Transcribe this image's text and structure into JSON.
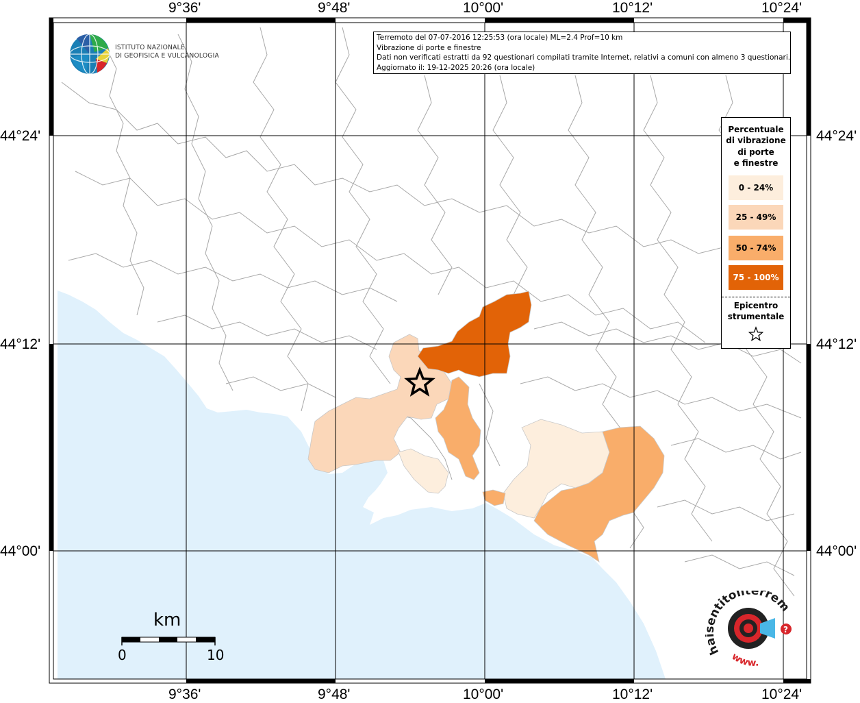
{
  "axes": {
    "top_ticks": [
      "9°36'",
      "9°48'",
      "10°00'",
      "10°12'",
      "10°24'"
    ],
    "bottom_ticks": [
      "9°36'",
      "9°48'",
      "10°00'",
      "10°12'",
      "10°24'"
    ],
    "left_ticks": [
      "44°24'",
      "44°12'",
      "44°00'"
    ],
    "right_ticks": [
      "44°24'",
      "44°12'",
      "44°00'"
    ]
  },
  "info": {
    "line1": "Terremoto del 07-07-2016 12:25:53 (ora locale) ML=2.4 Prof=10 km",
    "line2": "Vibrazione di porte e finestre",
    "line3": "Dati non verificati estratti da 92 questionari compilati tramite Internet, relativi a comuni con almeno 3 questionari.",
    "line4": "Aggiornato il: 19-12-2025 20:26 (ora locale)"
  },
  "logo": {
    "line1": "ISTITUTO NAZIONALE",
    "line2": "DI GEOFISICA E VULCANOLOGIA"
  },
  "legend": {
    "title_lines": [
      "Percentuale",
      "di vibrazione",
      "di porte",
      "e finestre"
    ],
    "classes": [
      {
        "label": "0 - 24%",
        "color": "#fdeedd",
        "text_color": "#000000"
      },
      {
        "label": "25 - 49%",
        "color": "#fbd7b9",
        "text_color": "#000000"
      },
      {
        "label": "50 - 74%",
        "color": "#f9ad6a",
        "text_color": "#000000"
      },
      {
        "label": "75 - 100%",
        "color": "#e26307",
        "text_color": "#ffffff"
      }
    ],
    "epicenter_lines": [
      "Epicentro",
      "strumentale"
    ]
  },
  "scale": {
    "unit": "km",
    "start": "0",
    "end": "10"
  },
  "watermark": {
    "text": "haisentitoilterremoto.it",
    "www": "www."
  },
  "colors": {
    "sea": "#e0f1fc",
    "land": "#ffffff",
    "border": "#9a9a9a",
    "grid": "#000000"
  }
}
